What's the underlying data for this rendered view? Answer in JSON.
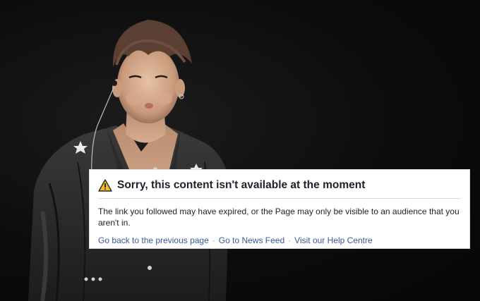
{
  "dialog": {
    "title": "Sorry, this content isn't available at the moment",
    "message": "The link you followed may have expired, or the Page may only be visible to an audience that you aren't in.",
    "icon": "warning-icon",
    "links": {
      "back": "Go back to the previous page",
      "news_feed": "Go to News Feed",
      "help": "Visit our Help Centre",
      "separator": "·"
    }
  },
  "background": {
    "description_icon": "person-photo"
  },
  "colors": {
    "link": "#385898",
    "title": "#1d2129",
    "warning_fill": "#f7b928"
  }
}
